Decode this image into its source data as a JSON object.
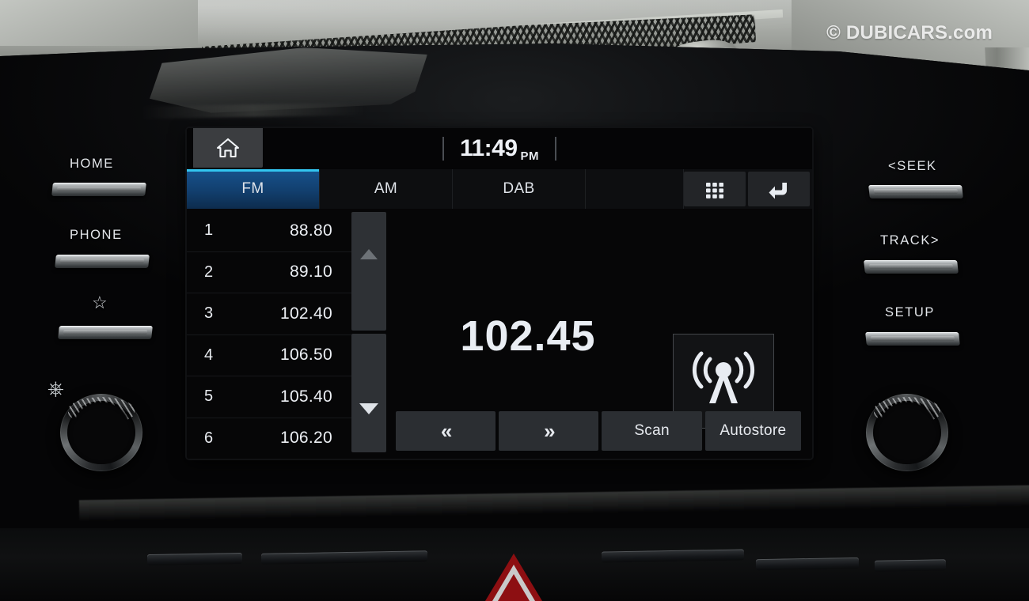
{
  "watermark": {
    "text": "© DUBICARS.com"
  },
  "screen": {
    "status_bar": {
      "home_icon": "home-icon",
      "clock": {
        "time": "11:49",
        "meridiem": "PM"
      }
    },
    "tabs": [
      {
        "label": "FM",
        "active": true
      },
      {
        "label": "AM",
        "active": false
      },
      {
        "label": "DAB",
        "active": false
      }
    ],
    "tab_actions": [
      {
        "icon": "grid-keypad-icon",
        "label": ""
      },
      {
        "icon": "back-arrow-icon",
        "label": ""
      }
    ],
    "presets": [
      {
        "number": "1",
        "frequency": "88.80"
      },
      {
        "number": "2",
        "frequency": "89.10"
      },
      {
        "number": "3",
        "frequency": "102.40"
      },
      {
        "number": "4",
        "frequency": "106.50"
      },
      {
        "number": "5",
        "frequency": "105.40"
      },
      {
        "number": "6",
        "frequency": "106.20"
      }
    ],
    "scroll": {
      "up_icon": "scroll-up-arrow-icon",
      "down_icon": "scroll-down-arrow-icon"
    },
    "now_playing": {
      "frequency": "102.45",
      "band_icon": "radio-broadcast-tower-icon"
    },
    "controls": [
      {
        "label": "«",
        "name": "tune-down-button"
      },
      {
        "label": "»",
        "name": "tune-up-button"
      },
      {
        "label": "Scan",
        "name": "scan-button"
      },
      {
        "label": "Autostore",
        "name": "autostore-button"
      }
    ],
    "accent_color": "#33c5f0",
    "active_tab_color": "#17528d"
  },
  "hardware": {
    "left_buttons": [
      {
        "label": "HOME"
      },
      {
        "label": "PHONE"
      },
      {
        "label": "☆"
      }
    ],
    "right_buttons": [
      {
        "label": "<SEEK"
      },
      {
        "label": "TRACK>"
      },
      {
        "label": "SETUP"
      }
    ],
    "power_icon": "power-icon",
    "left_knob": "volume-knob",
    "right_knob": "tune-knob",
    "hazard": "hazard-light-button"
  }
}
